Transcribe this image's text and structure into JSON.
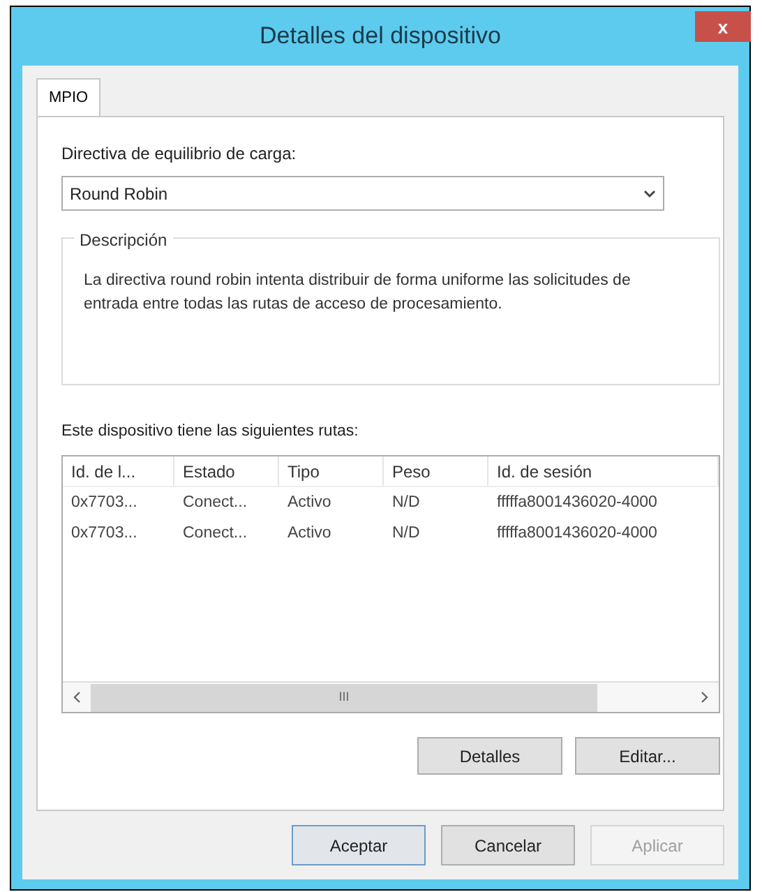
{
  "window": {
    "title": "Detalles del dispositivo",
    "close": "x"
  },
  "tabs": [
    {
      "label": "MPIO",
      "selected": true
    }
  ],
  "policy": {
    "label": "Directiva de equilibrio de carga:",
    "value": "Round Robin"
  },
  "description": {
    "legend": "Descripción",
    "text": "La directiva round robin intenta distribuir de forma uniforme las solicitudes de entrada entre todas las rutas de acceso de procesamiento."
  },
  "paths": {
    "label": "Este dispositivo tiene las siguientes rutas:",
    "columns": [
      "Id. de l...",
      "Estado",
      "Tipo",
      "Peso",
      "Id. de sesión"
    ],
    "rows": [
      [
        "0x7703...",
        "Conect...",
        "Activo",
        "N/D",
        "fffffa8001436020-4000"
      ],
      [
        "0x7703...",
        "Conect...",
        "Activo",
        "N/D",
        "fffffa8001436020-4000"
      ]
    ],
    "scroll_grip": "III",
    "buttons": [
      {
        "label": "Detalles",
        "disabled": false
      },
      {
        "label": "Editar...",
        "disabled": false
      }
    ]
  },
  "buttons": [
    {
      "label": "Aceptar",
      "default": true,
      "disabled": false
    },
    {
      "label": "Cancelar",
      "default": false,
      "disabled": false
    },
    {
      "label": "Aplicar",
      "default": false,
      "disabled": true
    }
  ]
}
